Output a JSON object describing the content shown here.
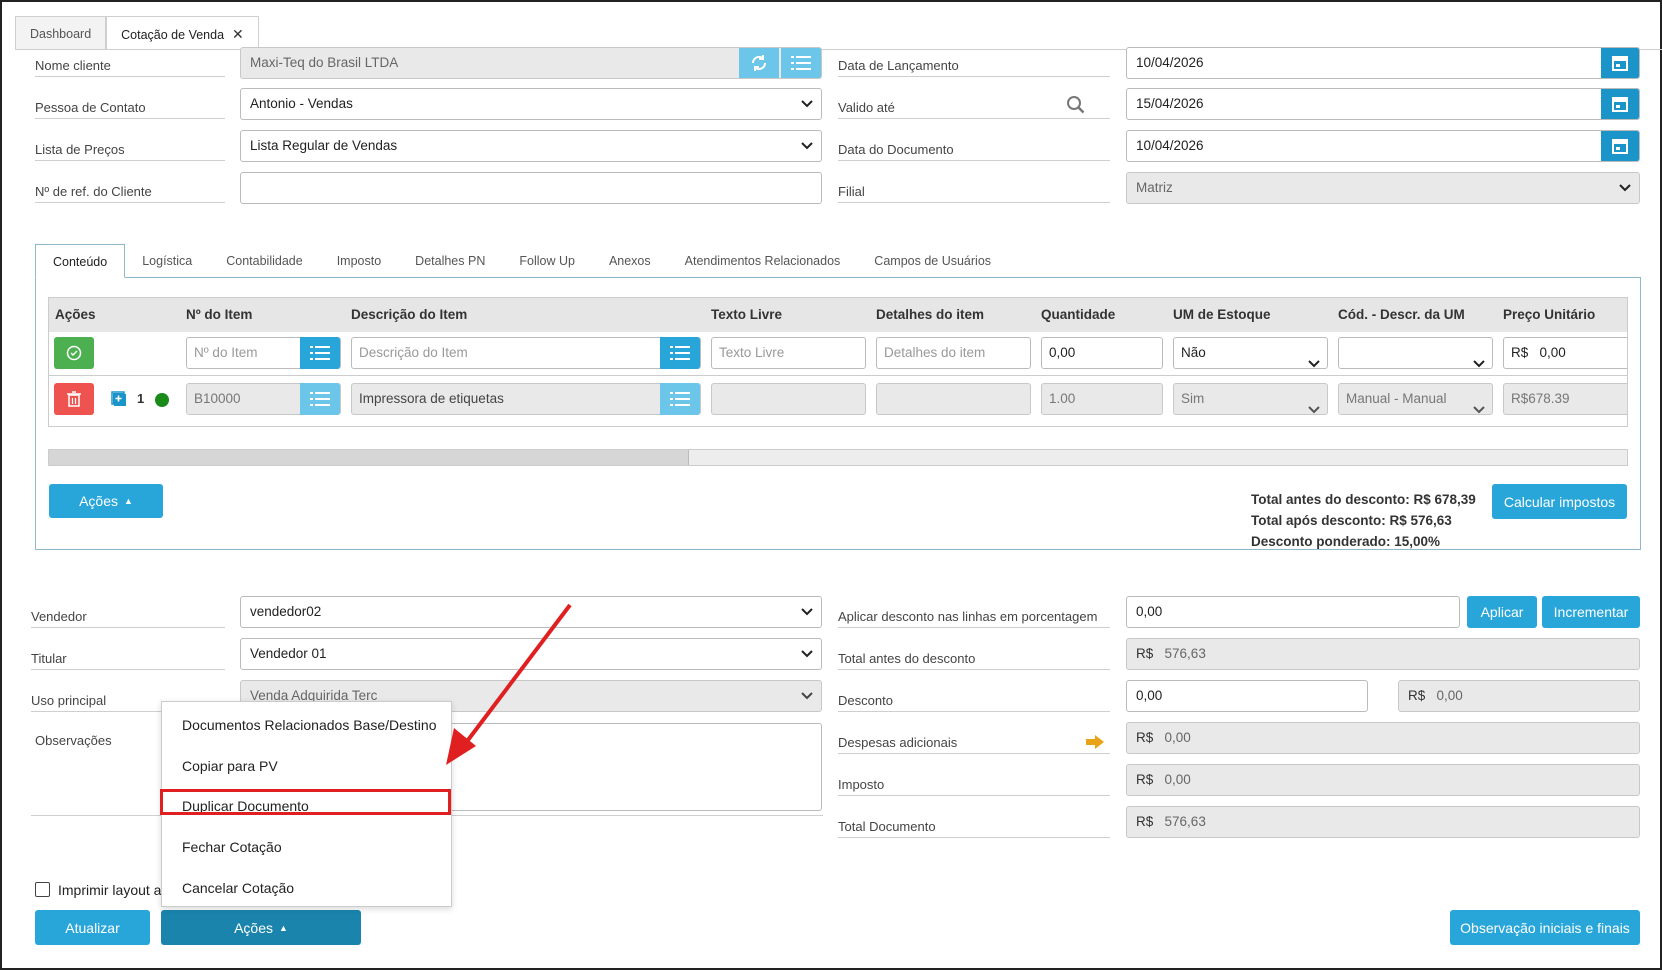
{
  "tabs": [
    {
      "label": "Dashboard"
    },
    {
      "label": "Cotação de Venda"
    }
  ],
  "header": {
    "nome_cliente": {
      "label": "Nome cliente",
      "value": "Maxi-Teq do Brasil LTDA"
    },
    "pessoa_contato": {
      "label": "Pessoa de Contato",
      "value": "Antonio - Vendas"
    },
    "lista_precos": {
      "label": "Lista de Preços",
      "value": "Lista Regular de Vendas"
    },
    "ref_cliente": {
      "label": "Nº de ref. do Cliente",
      "value": ""
    },
    "data_lancamento": {
      "label": "Data de Lançamento",
      "value": "10/04/2026"
    },
    "valido_ate": {
      "label": "Valido até",
      "value": "15/04/2026"
    },
    "data_documento": {
      "label": "Data do Documento",
      "value": "10/04/2026"
    },
    "filial": {
      "label": "Filial",
      "value": "Matriz"
    }
  },
  "inner_tabs": [
    "Conteúdo",
    "Logística",
    "Contabilidade",
    "Imposto",
    "Detalhes PN",
    "Follow Up",
    "Anexos",
    "Atendimentos Relacionados",
    "Campos de Usuários"
  ],
  "grid": {
    "columns": [
      "Ações",
      "Nº do Item",
      "Descrição do Item",
      "Texto Livre",
      "Detalhes do item",
      "Quantidade",
      "UM de Estoque",
      "Cód. - Descr. da UM",
      "Preço Unitário"
    ],
    "new_row": {
      "item_placeholder": "Nº do Item",
      "desc_placeholder": "Descrição do Item",
      "texto_placeholder": "Texto Livre",
      "detalhes_placeholder": "Detalhes do item",
      "quantidade": "0,00",
      "um_estoque": "Não",
      "cod_um": "",
      "preco_currency": "R$",
      "preco": "0,00"
    },
    "rows": [
      {
        "line": "1",
        "item": "B10000",
        "descricao": "Impressora de etiquetas",
        "texto": "",
        "detalhes": "",
        "quantidade": "1.00",
        "um_estoque": "Sim",
        "cod_um": "Manual - Manual",
        "preco": "R$678.39"
      }
    ]
  },
  "panel_actions": {
    "acoes_label": "Ações",
    "calc_label": "Calcular impostos",
    "total_antes": "Total antes do desconto: R$ 678,39",
    "total_apos": "Total após desconto: R$ 576,63",
    "desconto_ponderado": "Desconto ponderado: 15,00%"
  },
  "footer": {
    "vendedor": {
      "label": "Vendedor",
      "value": "vendedor02"
    },
    "titular": {
      "label": "Titular",
      "value": "Vendedor 01"
    },
    "uso_principal": {
      "label": "Uso principal",
      "value": "Venda Adquirida Terc"
    },
    "observacoes": {
      "label": "Observações"
    },
    "aplicar_desconto": {
      "label": "Aplicar desconto nas linhas em porcentagem",
      "value": "0,00",
      "aplicar": "Aplicar",
      "incrementar": "Incrementar"
    },
    "total_antes": {
      "label": "Total antes do desconto",
      "currency": "R$",
      "value": "576,63"
    },
    "desconto": {
      "label": "Desconto",
      "value": "0,00",
      "currency": "R$",
      "amount": "0,00"
    },
    "despesas": {
      "label": "Despesas adicionais",
      "currency": "R$",
      "value": "0,00"
    },
    "imposto": {
      "label": "Imposto",
      "currency": "R$",
      "value": "0,00"
    },
    "total_documento": {
      "label": "Total Documento",
      "currency": "R$",
      "value": "576,63"
    },
    "imprimir_label": "Imprimir layout a",
    "atualizar": "Atualizar",
    "acoes": "Ações",
    "observacao_btn": "Observação iniciais e finais"
  },
  "menu": {
    "items": [
      "Documentos Relacionados Base/Destino",
      "Copiar para PV",
      "Duplicar Documento",
      "Fechar Cotação",
      "Cancelar Cotação"
    ]
  },
  "colors": {
    "accent": "#29a6d9",
    "danger": "#ef5350",
    "success": "#4caf50",
    "highlight": "#e02020"
  }
}
